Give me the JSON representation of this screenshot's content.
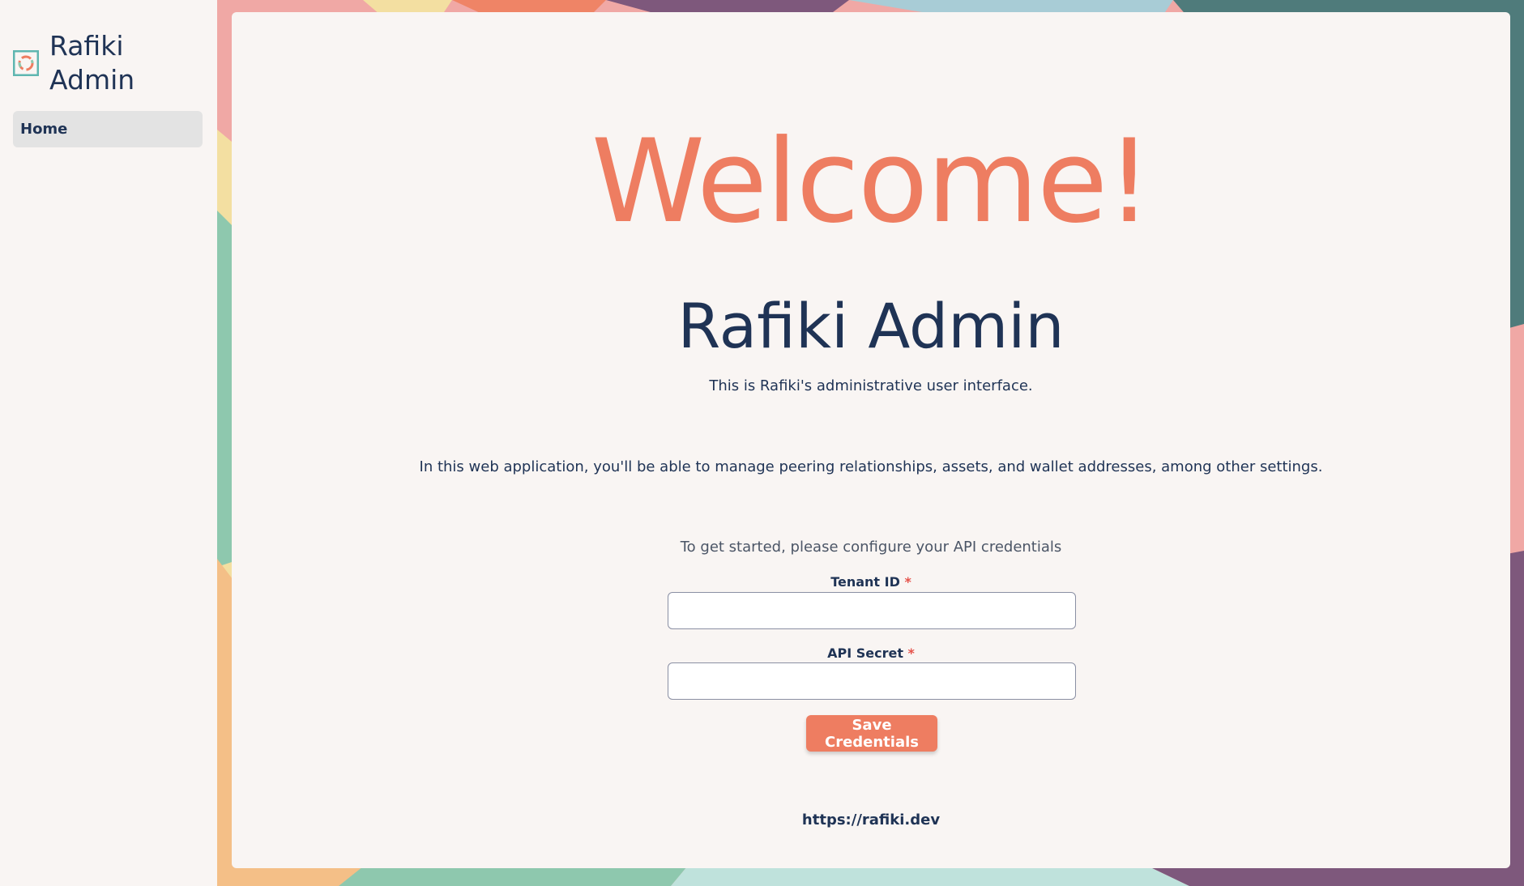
{
  "brand": {
    "name_line1": "Rafiki",
    "name_line2": "Admin",
    "logo_icon": "rafiki-ring-logo"
  },
  "sidebar": {
    "items": [
      {
        "label": "Home",
        "active": true
      }
    ]
  },
  "main": {
    "welcome": "Welcome!",
    "title": "Rafiki Admin",
    "intro": "This is Rafiki's administrative user interface.",
    "description": "In this web application, you'll be able to manage peering relationships, assets, and wallet addresses, among other settings.",
    "get_started": "To get started, please configure your API credentials",
    "form": {
      "tenant_id_label": "Tenant ID",
      "tenant_id_value": "",
      "api_secret_label": "API Secret",
      "api_secret_value": "",
      "required_marker": "*",
      "save_label": "Save Credentials"
    },
    "footer_link": "https://rafiki.dev"
  },
  "colors": {
    "accent": "#ee7d61",
    "text": "#1f3355",
    "background": "#f9f5f3"
  }
}
